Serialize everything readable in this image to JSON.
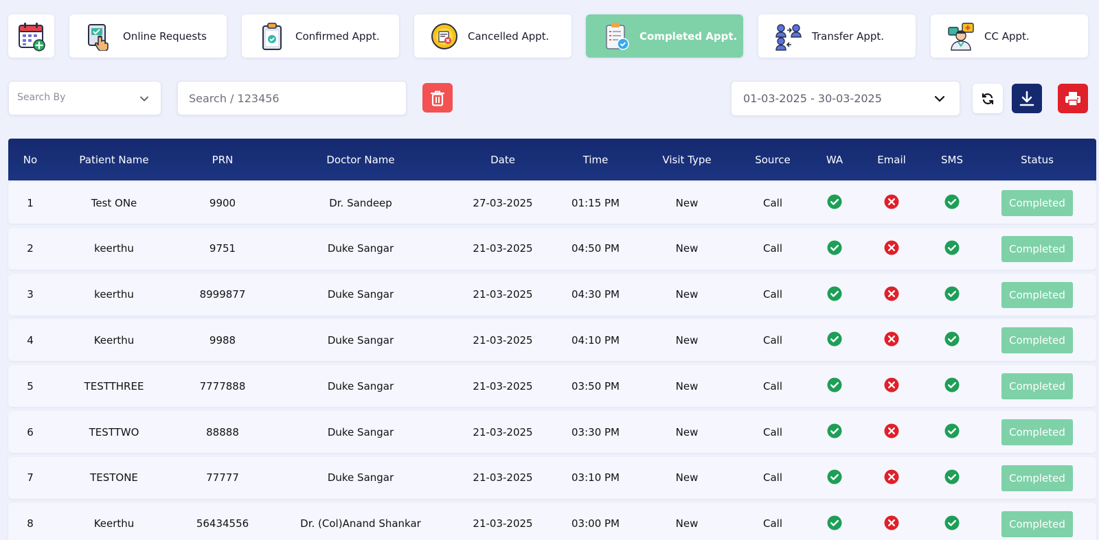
{
  "tabs": [
    {
      "label": "Online Requests",
      "icon": "online-requests-icon",
      "active": false
    },
    {
      "label": "Confirmed Appt.",
      "icon": "confirmed-clipboard-icon",
      "active": false
    },
    {
      "label": "Cancelled Appt.",
      "icon": "cancelled-coin-icon",
      "active": false
    },
    {
      "label": "Completed Appt.",
      "icon": "completed-clipboard-icon",
      "active": true
    },
    {
      "label": "Transfer Appt.",
      "icon": "transfer-users-icon",
      "active": false
    },
    {
      "label": "CC Appt.",
      "icon": "doctor-cc-icon",
      "active": false
    }
  ],
  "filters": {
    "search_by_label": "Search By",
    "search_placeholder": "Search / 123456",
    "date_range": "01-03-2025 - 30-03-2025"
  },
  "table": {
    "headers": [
      "No",
      "Patient Name",
      "PRN",
      "Doctor Name",
      "Date",
      "Time",
      "Visit Type",
      "Source",
      "WA",
      "Email",
      "SMS",
      "Status"
    ],
    "rows": [
      {
        "no": "1",
        "patient": "Test ONe",
        "prn": "9900",
        "doctor": "Dr. Sandeep",
        "date": "27-03-2025",
        "time": "01:15 PM",
        "visit": "New",
        "source": "Call",
        "wa": true,
        "email": false,
        "sms": true,
        "status": "Completed"
      },
      {
        "no": "2",
        "patient": "keerthu",
        "prn": "9751",
        "doctor": "Duke Sangar",
        "date": "21-03-2025",
        "time": "04:50 PM",
        "visit": "New",
        "source": "Call",
        "wa": true,
        "email": false,
        "sms": true,
        "status": "Completed"
      },
      {
        "no": "3",
        "patient": "keerthu",
        "prn": "8999877",
        "doctor": "Duke Sangar",
        "date": "21-03-2025",
        "time": "04:30 PM",
        "visit": "New",
        "source": "Call",
        "wa": true,
        "email": false,
        "sms": true,
        "status": "Completed"
      },
      {
        "no": "4",
        "patient": "Keerthu",
        "prn": "9988",
        "doctor": "Duke Sangar",
        "date": "21-03-2025",
        "time": "04:10 PM",
        "visit": "New",
        "source": "Call",
        "wa": true,
        "email": false,
        "sms": true,
        "status": "Completed"
      },
      {
        "no": "5",
        "patient": "TESTTHREE",
        "prn": "7777888",
        "doctor": "Duke Sangar",
        "date": "21-03-2025",
        "time": "03:50 PM",
        "visit": "New",
        "source": "Call",
        "wa": true,
        "email": false,
        "sms": true,
        "status": "Completed"
      },
      {
        "no": "6",
        "patient": "TESTTWO",
        "prn": "88888",
        "doctor": "Duke Sangar",
        "date": "21-03-2025",
        "time": "03:30 PM",
        "visit": "New",
        "source": "Call",
        "wa": true,
        "email": false,
        "sms": true,
        "status": "Completed"
      },
      {
        "no": "7",
        "patient": "TESTONE",
        "prn": "77777",
        "doctor": "Duke Sangar",
        "date": "21-03-2025",
        "time": "03:10 PM",
        "visit": "New",
        "source": "Call",
        "wa": true,
        "email": false,
        "sms": true,
        "status": "Completed"
      },
      {
        "no": "8",
        "patient": "Keerthu",
        "prn": "56434556",
        "doctor": "Dr. (Col)Anand Shankar",
        "date": "21-03-2025",
        "time": "03:00 PM",
        "visit": "New",
        "source": "Call",
        "wa": true,
        "email": false,
        "sms": true,
        "status": "Completed"
      }
    ]
  },
  "colors": {
    "header_bg": "#15296e",
    "active_tab": "#7fd1a8",
    "success": "#1e9e57",
    "fail": "#e0202a",
    "status_badge": "#7fd1a8"
  }
}
